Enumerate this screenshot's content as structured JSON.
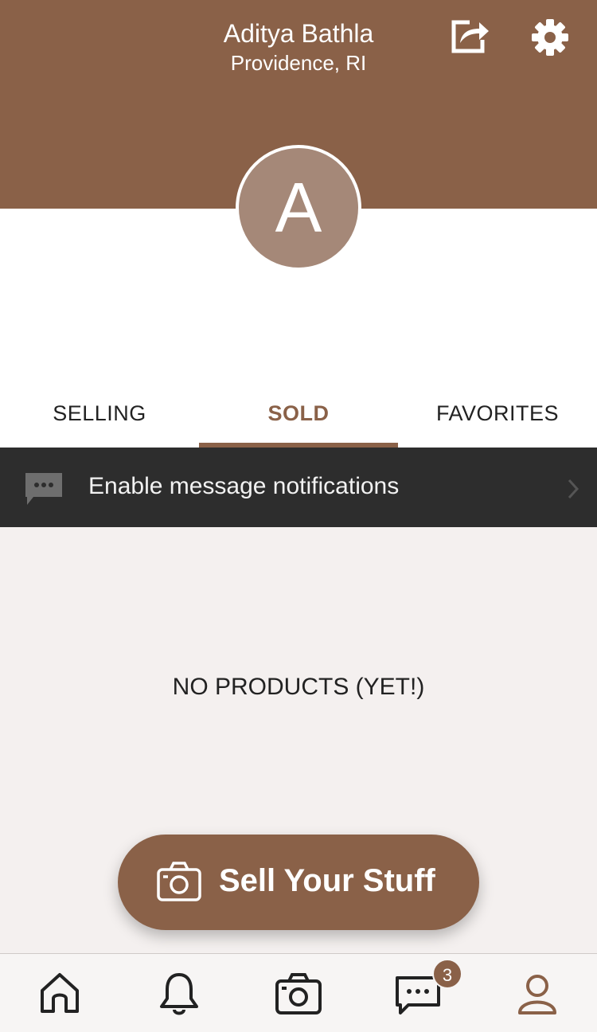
{
  "header": {
    "user_name": "Aditya Bathla",
    "location": "Providence, RI",
    "share_icon": "share-icon",
    "settings_icon": "gear-icon"
  },
  "profile": {
    "avatar_initial": "A",
    "avatar_color": "#a58878"
  },
  "tabs": [
    {
      "label": "SELLING",
      "active": false
    },
    {
      "label": "SOLD",
      "active": true
    },
    {
      "label": "FAVORITES",
      "active": false
    }
  ],
  "notification_banner": {
    "icon": "chat-bubble-icon",
    "text": "Enable message notifications",
    "chevron": "chevron-right-icon"
  },
  "empty_state": {
    "text": "NO PRODUCTS (YET!)"
  },
  "sell_button": {
    "icon": "camera-icon",
    "label": "Sell Your Stuff"
  },
  "bottom_nav": {
    "items": [
      {
        "name": "home",
        "icon": "home-icon"
      },
      {
        "name": "notifications",
        "icon": "bell-icon"
      },
      {
        "name": "sell",
        "icon": "camera-icon"
      },
      {
        "name": "messages",
        "icon": "chat-icon",
        "badge": "3"
      },
      {
        "name": "profile",
        "icon": "person-icon",
        "active": true
      }
    ]
  },
  "colors": {
    "brand": "#8a6148",
    "banner_bg": "#2d2d2d",
    "page_bg": "#f4f0ef"
  }
}
